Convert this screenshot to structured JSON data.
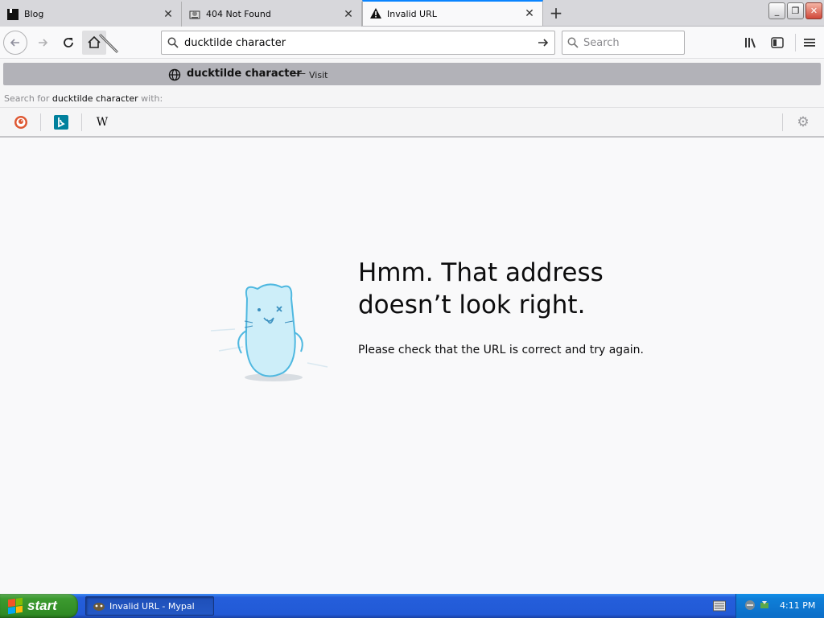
{
  "tabs": [
    {
      "title": "Blog",
      "favicon": "blog-favicon-icon",
      "active": false
    },
    {
      "title": "404 Not Found",
      "favicon": "server-favicon-icon",
      "active": false
    },
    {
      "title": "Invalid URL",
      "favicon": "warning-icon",
      "active": true
    }
  ],
  "urlbar": {
    "value": "ducktilde character"
  },
  "searchbar": {
    "placeholder": "Search"
  },
  "autocomplete": {
    "first_row": {
      "title": "ducktilde character",
      "separator": "—",
      "action": "Visit"
    },
    "search_for_prefix": "Search for",
    "search_for_query": "ducktilde character",
    "search_for_suffix": "with:",
    "engines": [
      {
        "name": "DuckDuckGo",
        "icon": "duckduckgo-icon"
      },
      {
        "name": "Bing",
        "icon": "bing-icon"
      },
      {
        "name": "Wikipedia",
        "icon": "wikipedia-icon",
        "glyph": "W"
      }
    ]
  },
  "error_page": {
    "title_line1": "Hmm. That address",
    "title_line2": "doesn’t look right.",
    "description": "Please check that the URL is correct and try again."
  },
  "taskbar": {
    "start_label": "start",
    "window_label": "Invalid URL - Mypal",
    "clock": "4:11 PM"
  },
  "colors": {
    "accent": "#0a84ff",
    "taskbar": "#245edb",
    "start": "#3c9a2f",
    "autocomplete_selected": "#b2b2b8"
  }
}
